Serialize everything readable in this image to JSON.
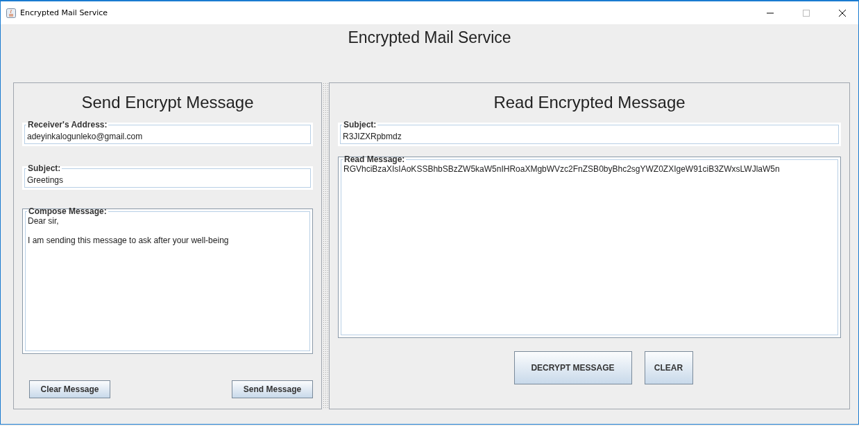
{
  "window": {
    "title": "Encrypted Mail Service"
  },
  "heading": "Encrypted Mail Service",
  "send_panel": {
    "title": "Send Encrypt Message",
    "fields": [
      {
        "label": "Receiver's Address:",
        "value": "adeyinkalogunleko@gmail.com"
      },
      {
        "label": "Subject:",
        "value": "Greetings"
      }
    ],
    "message": {
      "label": "Compose Message:",
      "value": "Dear sir,\n\nI am sending this message to ask after your well-being"
    },
    "buttons": [
      "Clear Message",
      "Send Message"
    ]
  },
  "read_panel": {
    "title": "Read Encrypted Message",
    "subject": {
      "label": "Subject:",
      "value": "R3JIZXRpbmdz"
    },
    "message": {
      "label": "Read Message:",
      "value": "RGVhciBzaXIsIAoKSSBhbSBzZW5kaW5nIHRoaXMgbWVzc2FnZSB0byBhc2sgYWZ0ZXIgeW91ciB3ZWxsLWJlaW5n"
    },
    "buttons": [
      "DECRYPT MESSAGE",
      "CLEAR"
    ]
  }
}
